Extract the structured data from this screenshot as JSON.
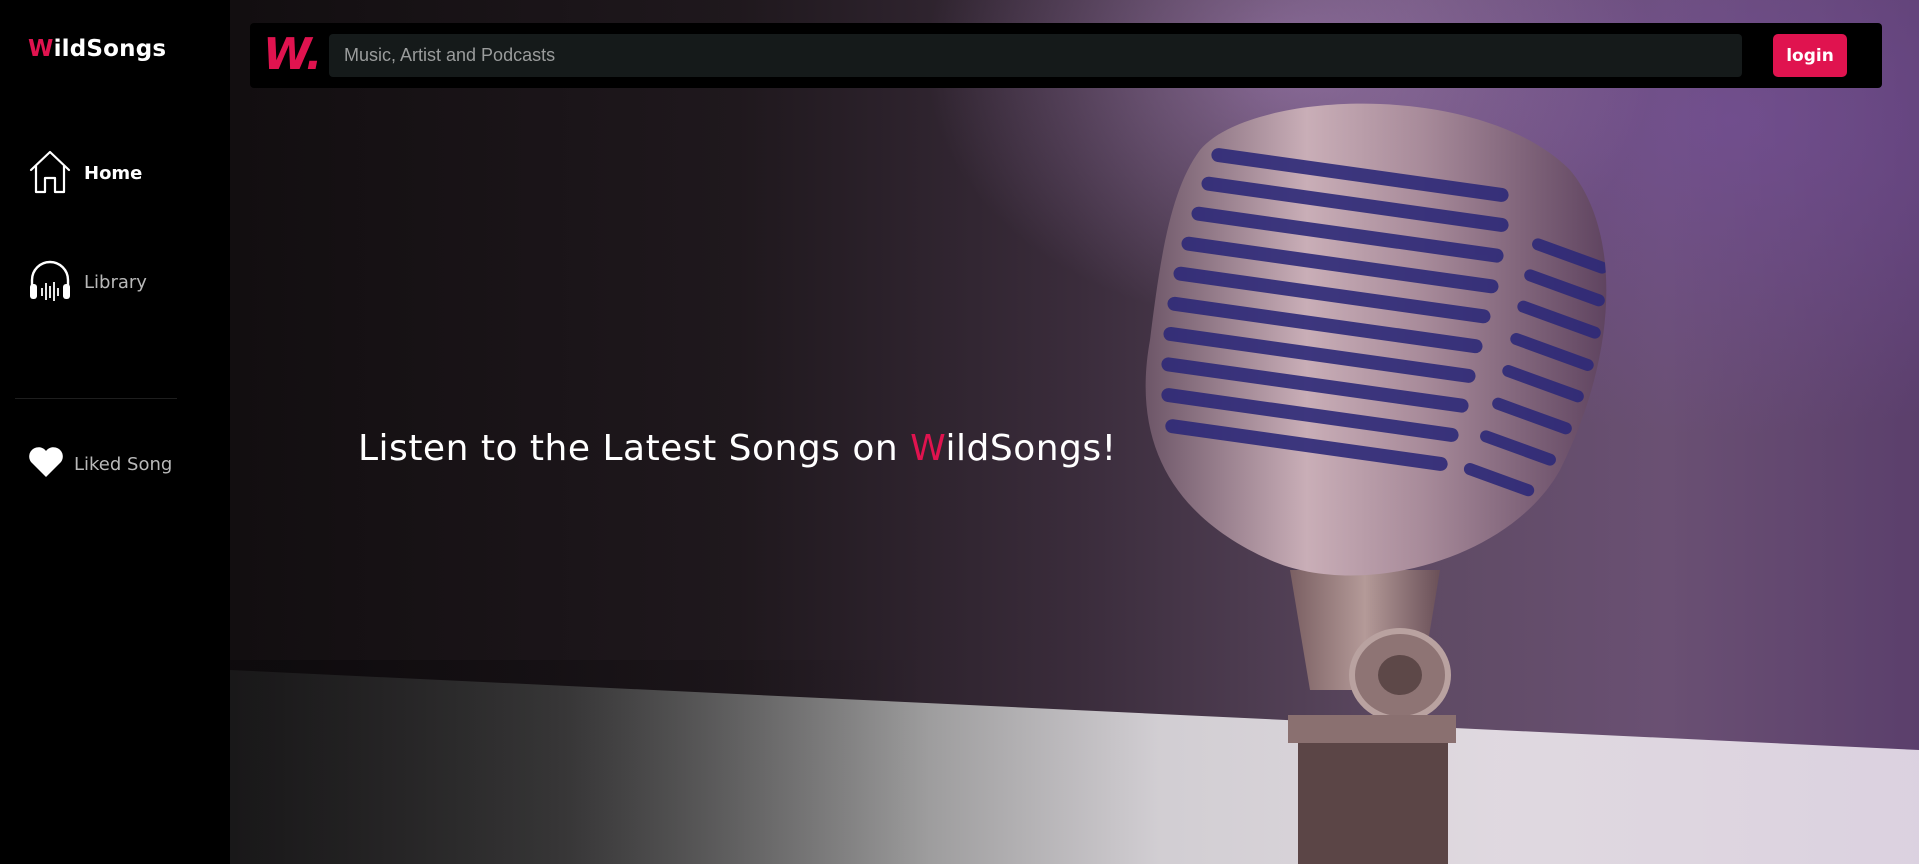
{
  "brand": {
    "accent_letter": "W",
    "rest": "ildSongs"
  },
  "sidebar": {
    "items": [
      {
        "label": "Home",
        "icon": "home-icon",
        "active": true
      },
      {
        "label": "Library",
        "icon": "headphones-icon",
        "active": false
      },
      {
        "label": "Liked Song",
        "icon": "heart-icon",
        "active": false
      }
    ]
  },
  "topbar": {
    "logo_text": "W.",
    "search_placeholder": "Music, Artist and Podcasts",
    "search_value": "",
    "login_label": "login"
  },
  "hero": {
    "headline_prefix": "Listen to the Latest Songs on ",
    "headline_accent": "W",
    "headline_suffix": "ildSongs!",
    "image": "microphone-photo"
  },
  "colors": {
    "accent": "#e0134f",
    "sidebar_bg": "#000000",
    "search_bg": "#151a1a"
  }
}
